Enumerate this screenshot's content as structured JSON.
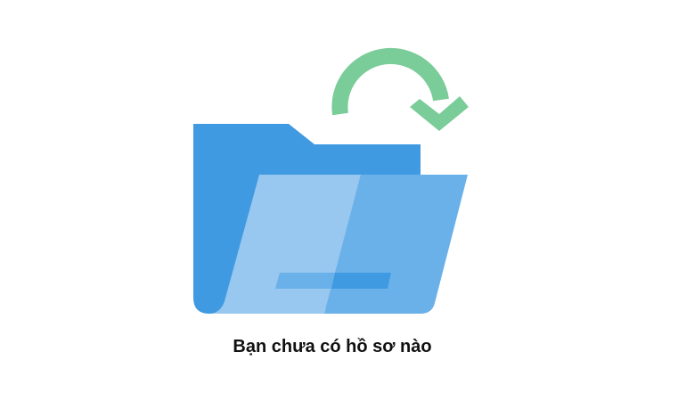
{
  "empty_state": {
    "message": "Bạn chưa có hồ sơ nào",
    "icon": "open-folder-with-arrow-icon",
    "colors": {
      "folder_back": "#3f9ae2",
      "folder_front_light": "#98c7ef",
      "folder_front": "#6ab1e9",
      "arrow": "#7acc98"
    }
  }
}
